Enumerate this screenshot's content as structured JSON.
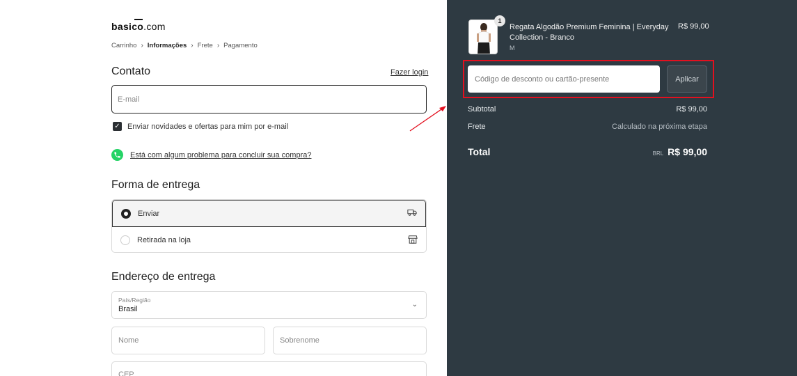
{
  "logo": {
    "brand": "basico",
    "tld": ".com"
  },
  "breadcrumb": {
    "cart": "Carrinho",
    "info": "Informações",
    "shipping": "Frete",
    "payment": "Pagamento"
  },
  "contact": {
    "heading": "Contato",
    "login_link": "Fazer login",
    "email_placeholder": "E-mail",
    "newsletter_label": "Enviar novidades e ofertas para mim por e-mail",
    "newsletter_checked": true,
    "help_link": "Está com algum problema para concluir sua compra?"
  },
  "delivery": {
    "heading": "Forma de entrega",
    "options": [
      {
        "label": "Enviar",
        "selected": true,
        "icon": "truck-icon"
      },
      {
        "label": "Retirada na loja",
        "selected": false,
        "icon": "store-icon"
      }
    ]
  },
  "address": {
    "heading": "Endereço de entrega",
    "country_label": "País/Região",
    "country_value": "Brasil",
    "first_name_placeholder": "Nome",
    "last_name_placeholder": "Sobrenome",
    "cep_placeholder": "CEP"
  },
  "summary": {
    "product": {
      "name": "Regata Algodão Premium Feminina | Everyday Collection - Branco",
      "variant": "M",
      "price": "R$ 99,00",
      "quantity": "1"
    },
    "discount_placeholder": "Código de desconto ou cartão-presente",
    "apply_label": "Aplicar",
    "subtotal_label": "Subtotal",
    "subtotal_value": "R$ 99,00",
    "shipping_label": "Frete",
    "shipping_value": "Calculado na próxima etapa",
    "total_label": "Total",
    "total_currency": "BRL",
    "total_value": "R$ 99,00"
  },
  "colors": {
    "panel_bg": "#2e3a42",
    "highlight": "#e3101f",
    "whatsapp": "#25d366"
  }
}
